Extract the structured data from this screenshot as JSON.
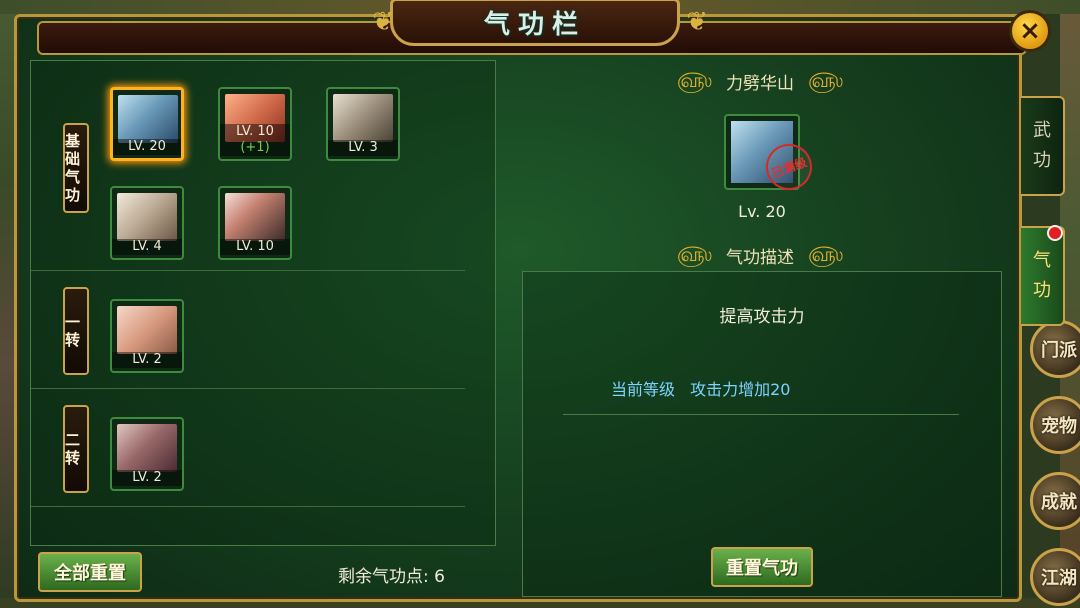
{
  "window": {
    "title": "气功栏",
    "close_icon": "×"
  },
  "left": {
    "sections": [
      {
        "label": "基础气功",
        "skills": [
          {
            "level": "LV. 20",
            "bonus": "",
            "icon": "fist-chain-icon",
            "selected": true
          },
          {
            "level": "LV. 10",
            "bonus": "(+1)",
            "icon": "sword-strike-icon",
            "selected": false
          },
          {
            "level": "LV. 3",
            "bonus": "",
            "icon": "scroll-icon",
            "selected": false
          },
          {
            "level": "LV. 4",
            "bonus": "",
            "icon": "beast-icon",
            "selected": false
          },
          {
            "level": "LV. 10",
            "bonus": "",
            "icon": "hero-portrait-icon",
            "selected": false
          }
        ]
      },
      {
        "label": "一转",
        "skills": [
          {
            "level": "LV. 2",
            "bonus": "",
            "icon": "palm-icon",
            "selected": false
          }
        ]
      },
      {
        "label": "二转",
        "skills": [
          {
            "level": "LV. 2",
            "bonus": "",
            "icon": "blade-icon",
            "selected": false
          }
        ]
      }
    ],
    "reset_all_label": "全部重置",
    "remaining_points_label": "剩余气功点: 6"
  },
  "detail": {
    "skill_name": "力劈华山",
    "level": "Lv. 20",
    "stamp_text": "已满级",
    "description_header": "气功描述",
    "description_title": "提高攻击力",
    "current_level_label": "当前等级",
    "current_effect": "攻击力增加20",
    "reset_button_label": "重置气功"
  },
  "side_tabs": [
    {
      "label_top": "武",
      "label_bottom": "功",
      "active": false
    },
    {
      "label_top": "气",
      "label_bottom": "功",
      "active": true,
      "badge": true
    }
  ],
  "scene": {
    "right_items": [
      "门派",
      "宠物",
      "成就",
      "江湖"
    ]
  },
  "colors": {
    "accent_gold": "#c9a24a",
    "panel_green": "#153e1e",
    "selected_orange": "#ffb21c",
    "effect_blue": "#7ed4ff",
    "bonus_green": "#6dd44a"
  }
}
